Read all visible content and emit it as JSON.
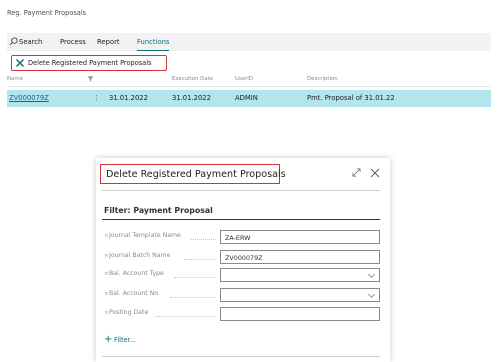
{
  "page": {
    "title": "Reg. Payment Proposals"
  },
  "action_bar": {
    "search_label": "Search",
    "process_label": "Process",
    "report_label": "Report",
    "functions_label": "Functions"
  },
  "command": {
    "label": "Delete Registered Payment Proposals"
  },
  "grid": {
    "columns": {
      "name": "Name",
      "date": "",
      "execution_date": "Execution Date",
      "user_id": "UserID",
      "description": "Description"
    },
    "row": {
      "name": "ZV000079Z",
      "date": "31.01.2022",
      "execution_date": "31.01.2022",
      "user_id": "ADMIN",
      "description": "Pmt. Proposal of 31.01.22"
    }
  },
  "dialog": {
    "title": "Delete Registered Payment Proposals",
    "filter_title": "Filter: Payment Proposal",
    "fields": [
      {
        "label": "Journal Template Name",
        "value": "ZA-ERW"
      },
      {
        "label": "Journal Batch Name",
        "value": "ZV000079Z"
      },
      {
        "label": "Bal. Account Type",
        "value": ""
      },
      {
        "label": "Bal. Account No.",
        "value": ""
      },
      {
        "label": "Posting Date",
        "value": ""
      }
    ],
    "add_filter_label": "Filter..."
  },
  "colors": {
    "accent": "#0f6b7d",
    "selected_row": "#b2e6ec",
    "highlight_border": "#d13438",
    "link": "#1a5c99"
  },
  "icons": [
    "search-icon",
    "delete-x-icon",
    "filter-funnel-icon",
    "expand-icon",
    "close-icon",
    "remove-x-icon",
    "plus-icon"
  ]
}
